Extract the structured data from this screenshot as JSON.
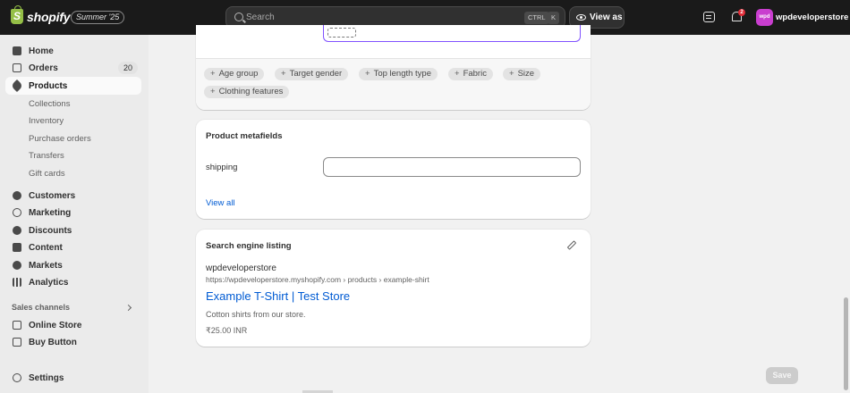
{
  "topbar": {
    "logo_text": "shopify",
    "edition": "Summer '25",
    "search_placeholder": "Search",
    "shortcut_ctrl": "CTRL",
    "shortcut_k": "K",
    "view_as": "View as",
    "notifications_count": "2",
    "store_initials": "wpd",
    "store_name": "wpdeveloperstore"
  },
  "sidebar": {
    "items": [
      {
        "label": "Home",
        "icon": "home-icon"
      },
      {
        "label": "Orders",
        "icon": "orders-icon",
        "count": "20"
      },
      {
        "label": "Products",
        "icon": "tag-icon",
        "active": true
      },
      {
        "label": "Collections"
      },
      {
        "label": "Inventory"
      },
      {
        "label": "Purchase orders"
      },
      {
        "label": "Transfers"
      },
      {
        "label": "Gift cards"
      },
      {
        "label": "Customers",
        "icon": "person-icon"
      },
      {
        "label": "Marketing",
        "icon": "target-icon"
      },
      {
        "label": "Discounts",
        "icon": "discount-icon"
      },
      {
        "label": "Content",
        "icon": "content-icon"
      },
      {
        "label": "Markets",
        "icon": "globe-icon"
      },
      {
        "label": "Analytics",
        "icon": "chart-icon"
      },
      {
        "label": "Online Store",
        "icon": "store-icon"
      },
      {
        "label": "Buy Button",
        "icon": "buy-button-icon"
      },
      {
        "label": "Settings",
        "icon": "gear-icon"
      }
    ],
    "sales_channels_heading": "Sales channels"
  },
  "attributes_card": {
    "chips": [
      "Age group",
      "Target gender",
      "Top length type",
      "Fabric",
      "Size",
      "Clothing features"
    ]
  },
  "metafields_card": {
    "title": "Product metafields",
    "field_label": "shipping",
    "field_value": "",
    "view_all": "View all"
  },
  "seo_card": {
    "title": "Search engine listing",
    "store": "wpdeveloperstore",
    "url": "https://wpdeveloperstore.myshopify.com › products › example-shirt",
    "page_title": "Example T-Shirt | Test Store",
    "description": "Cotton shirts from our store.",
    "price": "₹25.00 INR"
  },
  "footer": {
    "save_label": "Save"
  }
}
